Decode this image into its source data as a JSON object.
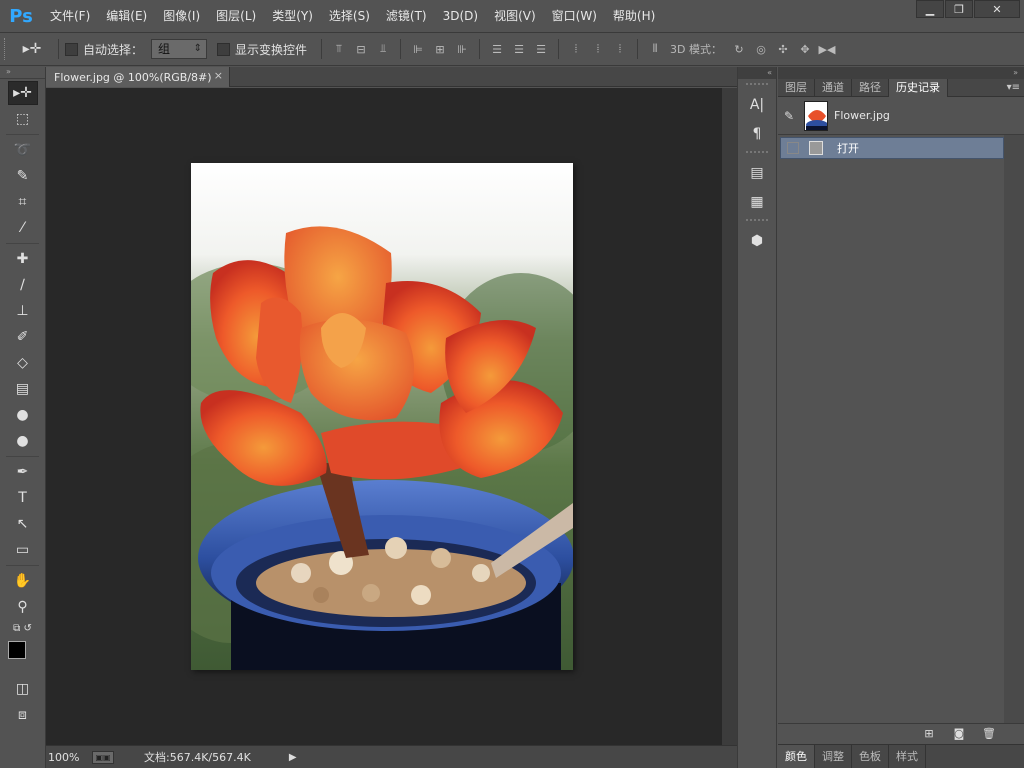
{
  "app": {
    "logo": "Ps"
  },
  "menu": [
    "文件(F)",
    "编辑(E)",
    "图像(I)",
    "图层(L)",
    "类型(Y)",
    "选择(S)",
    "滤镜(T)",
    "3D(D)",
    "视图(V)",
    "窗口(W)",
    "帮助(H)"
  ],
  "window_controls": {
    "minimize": "▁",
    "maximize": "❐",
    "close": "✕"
  },
  "options": {
    "tool_icon": "move-tool-icon",
    "auto_select_label": "自动选择：",
    "auto_select_value": "组",
    "show_transform_label": "显示变换控件",
    "threed_label": "3D 模式："
  },
  "document": {
    "tab_title": "Flower.jpg @ 100%(RGB/8#)",
    "tab_close": "×",
    "zoom": "100%",
    "doc_info": "文档:567.4K/567.4K"
  },
  "right_panel": {
    "tabs": [
      "图层",
      "通道",
      "路径",
      "历史记录"
    ],
    "active_tab": 3,
    "snapshot_label": "Flower.jpg",
    "history_items": [
      "打开"
    ],
    "bottom_tabs": [
      "颜色",
      "调整",
      "色板",
      "样式"
    ]
  },
  "colors": {
    "foreground": "#000000",
    "background": "#000000",
    "history_selected": "#6e7e96"
  }
}
